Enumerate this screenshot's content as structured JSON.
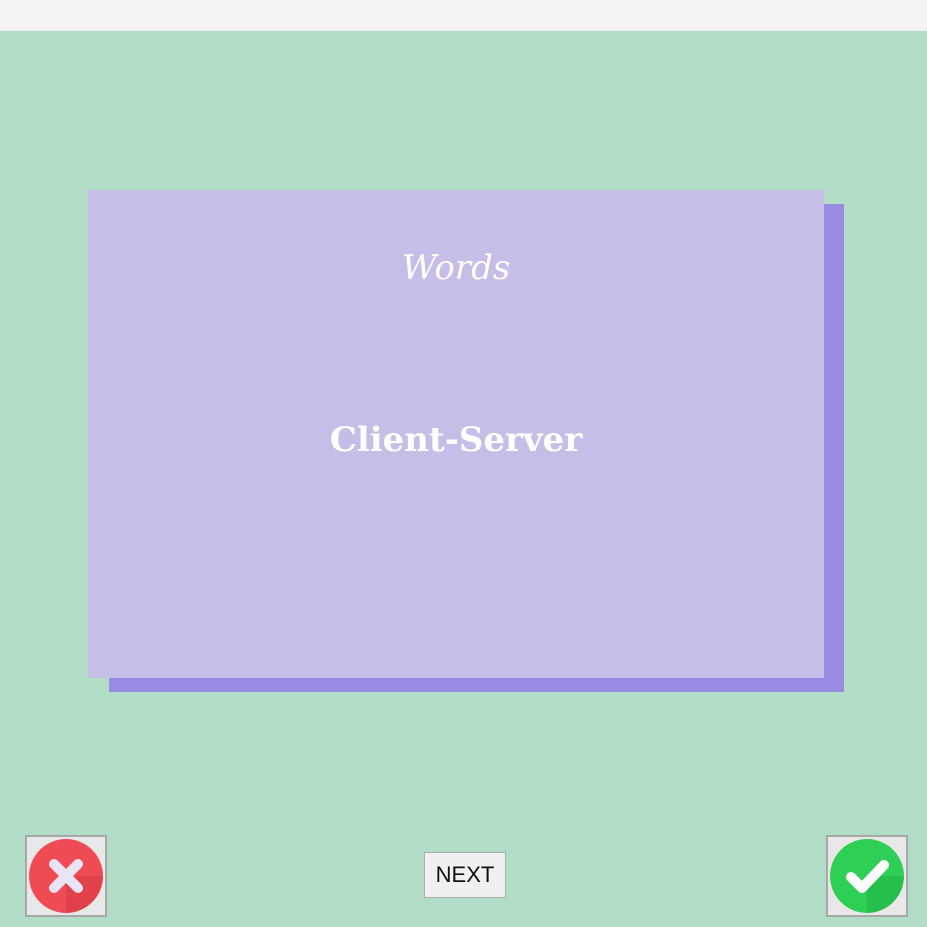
{
  "card": {
    "category": "Words",
    "term": "Client-Server"
  },
  "controls": {
    "next_label": "NEXT",
    "wrong_icon": "x-circle-icon",
    "correct_icon": "check-circle-icon"
  },
  "colors": {
    "background": "#b1ddc7",
    "card": "#c6bee6",
    "card_shadow": "#9b8ae4",
    "wrong": "#ee4b55",
    "correct": "#2fcf55"
  }
}
